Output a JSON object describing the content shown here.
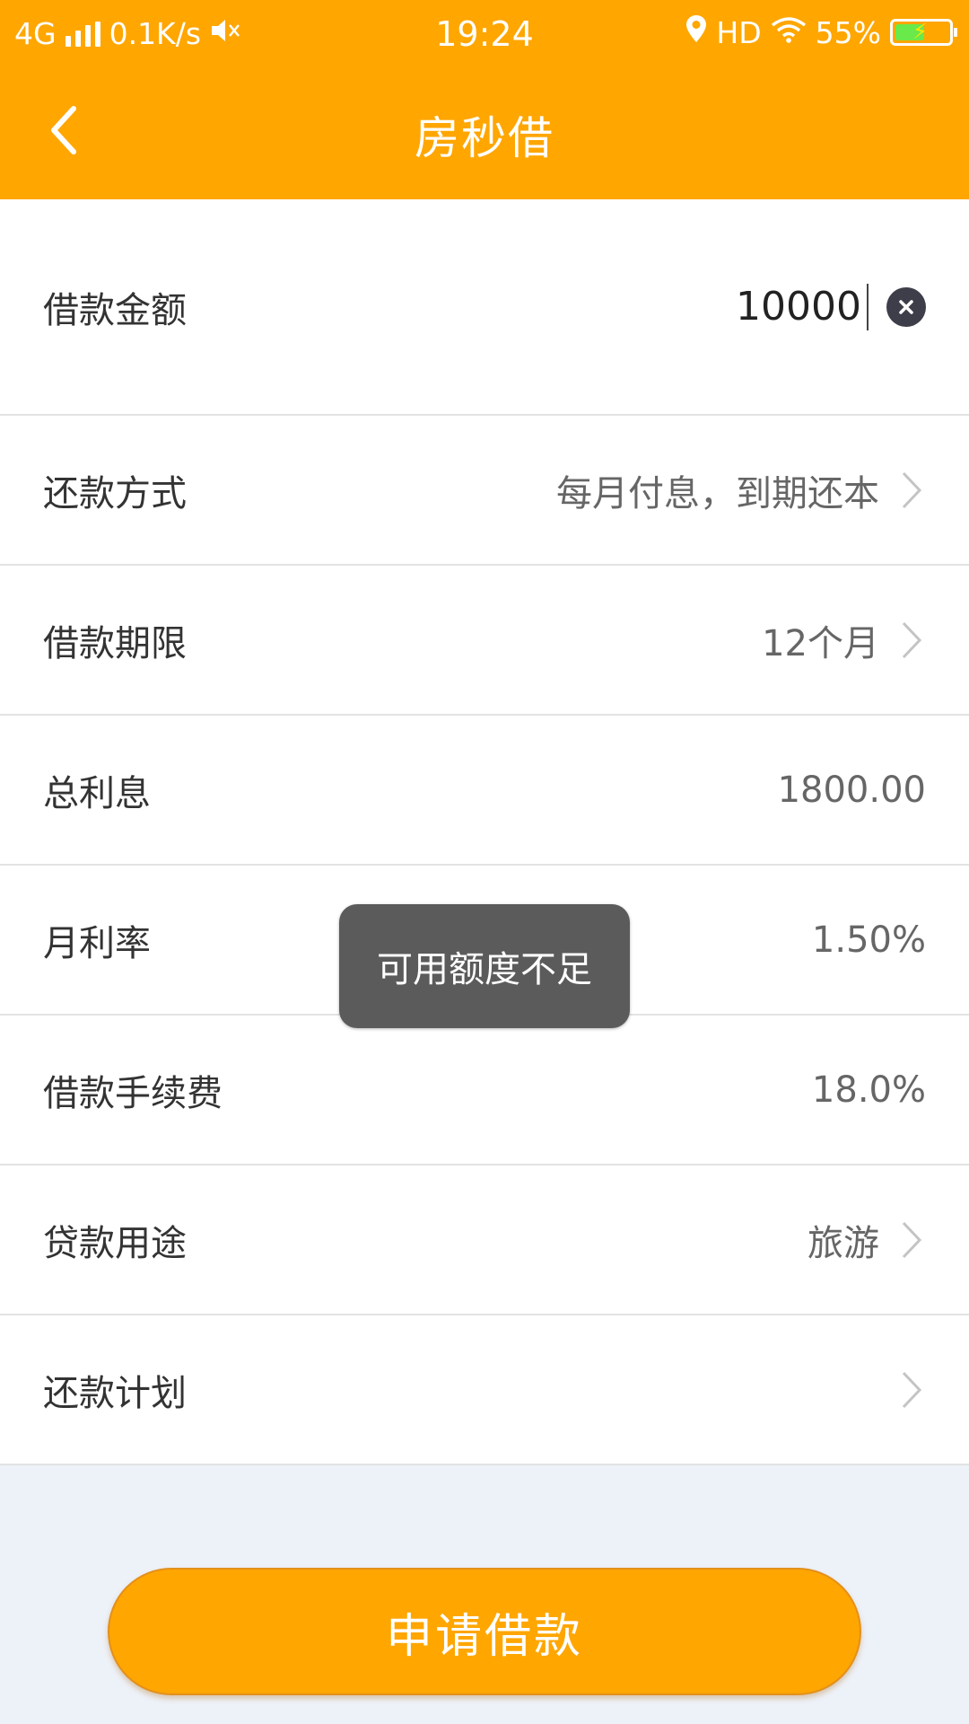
{
  "colors": {
    "brand": "#FFA600",
    "background": "#edf1f8",
    "toast": "#5b5b5b"
  },
  "status_bar": {
    "network": "4G",
    "speed": "0.1K/s",
    "time": "19:24",
    "hd": "HD",
    "battery_percent_label": "55%",
    "battery_level": 0.55,
    "icons": [
      "signal-icon",
      "mute-icon",
      "location-icon",
      "wifi-icon",
      "battery-icon"
    ]
  },
  "header": {
    "title": "房秒借",
    "back_icon": "back-chevron-icon"
  },
  "form": {
    "amount": {
      "label": "借款金额",
      "value": "10000"
    },
    "repayment_method": {
      "label": "还款方式",
      "value": "每月付息，到期还本"
    },
    "term": {
      "label": "借款期限",
      "value": "12个月"
    },
    "total_interest": {
      "label": "总利息",
      "value": "1800.00"
    },
    "monthly_rate": {
      "label": "月利率",
      "value": "1.50%"
    },
    "fee": {
      "label": "借款手续费",
      "value": "18.0%"
    },
    "purpose": {
      "label": "贷款用途",
      "value": "旅游"
    },
    "schedule": {
      "label": "还款计划"
    }
  },
  "toast": {
    "message": "可用额度不足"
  },
  "actions": {
    "apply_label": "申请借款"
  }
}
